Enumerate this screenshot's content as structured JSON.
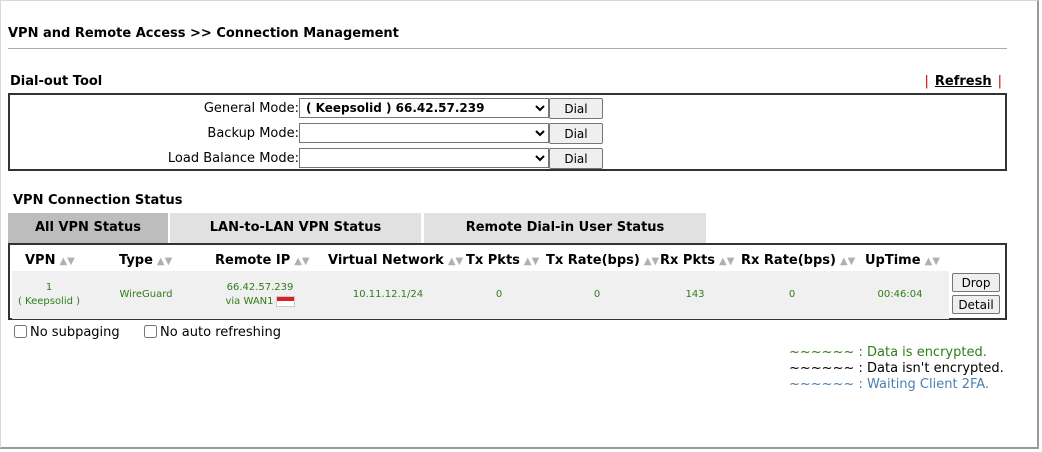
{
  "page": {
    "title": "VPN and Remote Access >> Connection Management"
  },
  "dialout": {
    "label": "Dial-out Tool",
    "refresh": "Refresh",
    "rows": [
      {
        "label": "General Mode:",
        "value": "( Keepsolid ) 66.42.57.239",
        "button": "Dial"
      },
      {
        "label": "Backup Mode:",
        "value": "",
        "button": "Dial"
      },
      {
        "label": "Load Balance Mode:",
        "value": "",
        "button": "Dial"
      }
    ]
  },
  "status": {
    "label": "VPN Connection Status",
    "tabs": [
      "All VPN Status",
      "LAN-to-LAN VPN Status",
      "Remote Dial-in User Status"
    ],
    "columns": [
      "VPN",
      "Type",
      "Remote IP",
      "Virtual Network",
      "Tx Pkts",
      "Tx Rate(bps)",
      "Rx Pkts",
      "Rx Rate(bps)",
      "UpTime"
    ],
    "row": {
      "vpn_num": "1",
      "vpn_name": "( Keepsolid )",
      "type": "WireGuard",
      "remote_ip": "66.42.57.239",
      "remote_via": "via WAN1",
      "virtual_network": "10.11.12.1/24",
      "tx_pkts": "0",
      "tx_rate": "0",
      "rx_pkts": "143",
      "rx_rate": "0",
      "uptime": "00:46:04",
      "drop": "Drop",
      "detail": "Detail"
    }
  },
  "options": {
    "no_subpaging": "No subpaging",
    "no_auto_refresh": "No auto refreshing"
  },
  "legend": [
    {
      "text": "~~~~~~ : Data is encrypted.",
      "color": "#2f7d1a"
    },
    {
      "text": "~~~~~~ : Data isn't encrypted.",
      "color": "#000000"
    },
    {
      "text": "~~~~~~ : Waiting Client 2FA.",
      "color": "#4a7fb0"
    }
  ]
}
